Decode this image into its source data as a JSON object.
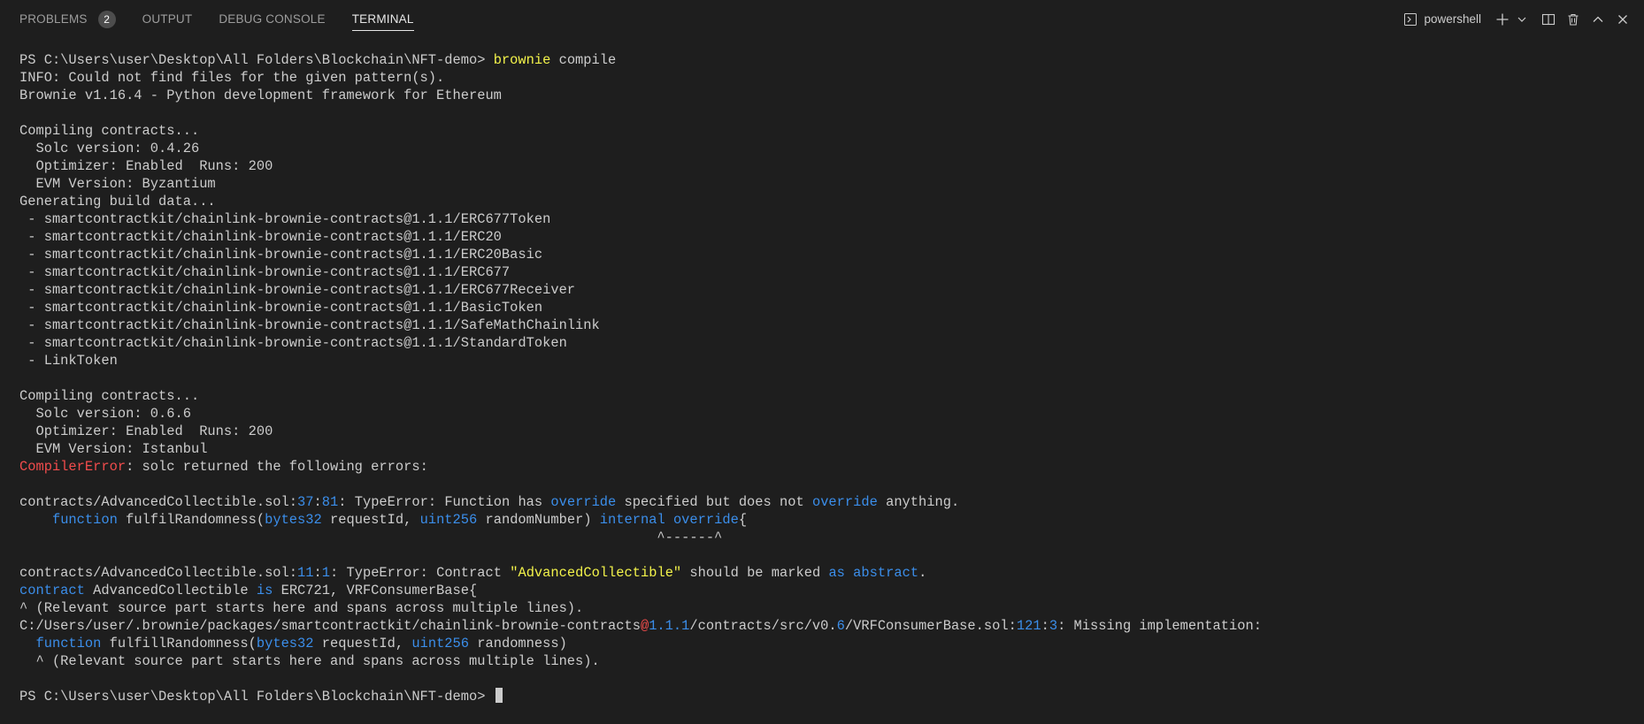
{
  "panel": {
    "tabs": [
      {
        "label": "PROBLEMS",
        "badge": "2"
      },
      {
        "label": "OUTPUT"
      },
      {
        "label": "DEBUG CONSOLE"
      },
      {
        "label": "TERMINAL",
        "active": true
      }
    ],
    "shell_label": "powershell",
    "icons": [
      "terminal-icon",
      "plus-icon",
      "chevron-down-icon",
      "split-icon",
      "trash-icon",
      "chevron-up-icon",
      "close-icon"
    ]
  },
  "colors": {
    "background": "#1e1e1e",
    "text": "#cccccc",
    "yellow": "#f2f24a",
    "red": "#f14c4c",
    "blue": "#3b8eea"
  },
  "terminal": {
    "lines": [
      [
        {
          "t": "PS C:\\Users\\user\\Desktop\\All Folders\\Blockchain\\NFT-demo> "
        },
        {
          "t": "brownie",
          "c": "y"
        },
        {
          "t": " compile"
        }
      ],
      [
        {
          "t": "INFO: Could not find files for the given pattern(s)."
        }
      ],
      [
        {
          "t": "Brownie v1.16.4 - Python development framework for Ethereum"
        }
      ],
      [
        {
          "t": ""
        }
      ],
      [
        {
          "t": "Compiling contracts..."
        }
      ],
      [
        {
          "t": "  Solc version: 0.4.26"
        }
      ],
      [
        {
          "t": "  Optimizer: Enabled  Runs: 200"
        }
      ],
      [
        {
          "t": "  EVM Version: Byzantium"
        }
      ],
      [
        {
          "t": "Generating build data..."
        }
      ],
      [
        {
          "t": " - smartcontractkit/chainlink-brownie-contracts@1.1.1/ERC677Token"
        }
      ],
      [
        {
          "t": " - smartcontractkit/chainlink-brownie-contracts@1.1.1/ERC20"
        }
      ],
      [
        {
          "t": " - smartcontractkit/chainlink-brownie-contracts@1.1.1/ERC20Basic"
        }
      ],
      [
        {
          "t": " - smartcontractkit/chainlink-brownie-contracts@1.1.1/ERC677"
        }
      ],
      [
        {
          "t": " - smartcontractkit/chainlink-brownie-contracts@1.1.1/ERC677Receiver"
        }
      ],
      [
        {
          "t": " - smartcontractkit/chainlink-brownie-contracts@1.1.1/BasicToken"
        }
      ],
      [
        {
          "t": " - smartcontractkit/chainlink-brownie-contracts@1.1.1/SafeMathChainlink"
        }
      ],
      [
        {
          "t": " - smartcontractkit/chainlink-brownie-contracts@1.1.1/StandardToken"
        }
      ],
      [
        {
          "t": " - LinkToken"
        }
      ],
      [
        {
          "t": ""
        }
      ],
      [
        {
          "t": "Compiling contracts..."
        }
      ],
      [
        {
          "t": "  Solc version: 0.6.6"
        }
      ],
      [
        {
          "t": "  Optimizer: Enabled  Runs: 200"
        }
      ],
      [
        {
          "t": "  EVM Version: Istanbul"
        }
      ],
      [
        {
          "t": "CompilerError",
          "c": "r"
        },
        {
          "t": ": solc returned the following errors:"
        }
      ],
      [
        {
          "t": ""
        }
      ],
      [
        {
          "t": "contracts/AdvancedCollectible.sol:"
        },
        {
          "t": "37",
          "c": "b"
        },
        {
          "t": ":"
        },
        {
          "t": "81",
          "c": "b"
        },
        {
          "t": ": TypeError: Function has "
        },
        {
          "t": "override",
          "c": "b"
        },
        {
          "t": " specified but does not "
        },
        {
          "t": "override",
          "c": "b"
        },
        {
          "t": " anything."
        }
      ],
      [
        {
          "t": "    "
        },
        {
          "t": "function",
          "c": "b"
        },
        {
          "t": " fulfilRandomness("
        },
        {
          "t": "bytes32",
          "c": "b"
        },
        {
          "t": " requestId, "
        },
        {
          "t": "uint256",
          "c": "b"
        },
        {
          "t": " randomNumber) "
        },
        {
          "t": "internal",
          "c": "b"
        },
        {
          "t": " "
        },
        {
          "t": "override",
          "c": "b"
        },
        {
          "t": "{"
        }
      ],
      [
        {
          "t": "                                                                              ^------^"
        }
      ],
      [
        {
          "t": ""
        }
      ],
      [
        {
          "t": "contracts/AdvancedCollectible.sol:"
        },
        {
          "t": "11",
          "c": "b"
        },
        {
          "t": ":"
        },
        {
          "t": "1",
          "c": "b"
        },
        {
          "t": ": TypeError: Contract "
        },
        {
          "t": "\"AdvancedCollectible\"",
          "c": "y"
        },
        {
          "t": " should be marked "
        },
        {
          "t": "as",
          "c": "b"
        },
        {
          "t": " "
        },
        {
          "t": "abstract",
          "c": "b"
        },
        {
          "t": "."
        }
      ],
      [
        {
          "t": "contract",
          "c": "b"
        },
        {
          "t": " AdvancedCollectible "
        },
        {
          "t": "is",
          "c": "b"
        },
        {
          "t": " ERC721, VRFConsumerBase{"
        }
      ],
      [
        {
          "t": "^ (Relevant source part starts here and spans across multiple lines)."
        }
      ],
      [
        {
          "t": "C:/Users/user/.brownie/packages/smartcontractkit/chainlink-brownie-contracts"
        },
        {
          "t": "@",
          "c": "r"
        },
        {
          "t": "1.1.1",
          "c": "b"
        },
        {
          "t": "/contracts/src/v0."
        },
        {
          "t": "6",
          "c": "b"
        },
        {
          "t": "/VRFConsumerBase.sol:"
        },
        {
          "t": "121",
          "c": "b"
        },
        {
          "t": ":"
        },
        {
          "t": "3",
          "c": "b"
        },
        {
          "t": ": Missing implementation:"
        }
      ],
      [
        {
          "t": "  "
        },
        {
          "t": "function",
          "c": "b"
        },
        {
          "t": " fulfillRandomness("
        },
        {
          "t": "bytes32",
          "c": "b"
        },
        {
          "t": " requestId, "
        },
        {
          "t": "uint256",
          "c": "b"
        },
        {
          "t": " randomness)"
        }
      ],
      [
        {
          "t": "  ^ (Relevant source part starts here and spans across multiple lines)."
        }
      ],
      [
        {
          "t": ""
        }
      ],
      [
        {
          "t": "PS C:\\Users\\user\\Desktop\\All Folders\\Blockchain\\NFT-demo> "
        }
      ]
    ]
  }
}
